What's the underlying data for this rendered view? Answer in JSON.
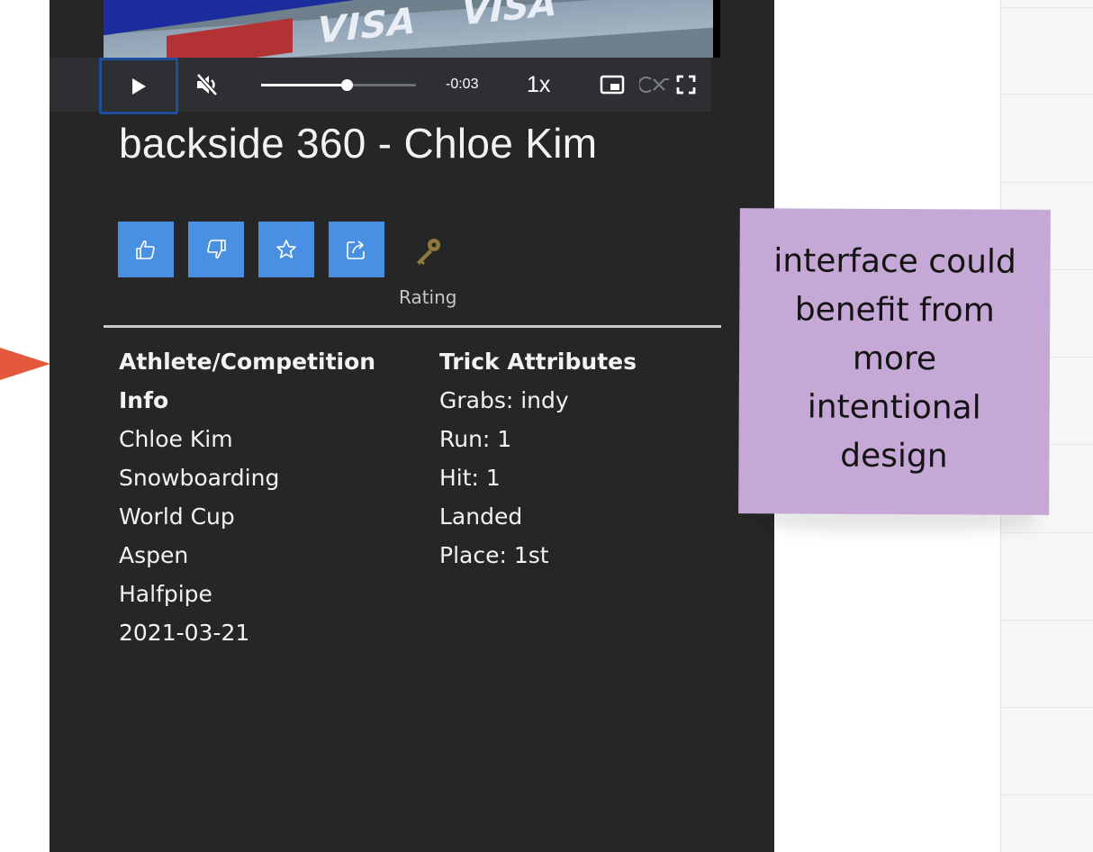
{
  "video": {
    "banner_text_1": "VISA",
    "banner_text_2": "VISA",
    "time_remaining": "-0:03",
    "playback_speed": "1x",
    "progress_fraction": 0.55
  },
  "title": "backside 360 - Chloe Kim",
  "actions": {
    "rating_label": "Rating",
    "accent_color": "#4a90e2",
    "buttons": [
      {
        "name": "like",
        "icon": "thumbs-up-icon"
      },
      {
        "name": "dislike",
        "icon": "thumbs-down-icon"
      },
      {
        "name": "favorite",
        "icon": "star-icon"
      },
      {
        "name": "share",
        "icon": "share-icon"
      }
    ]
  },
  "athlete_info": {
    "heading_line1": "Athlete/Competition",
    "heading_line2": "Info",
    "lines": [
      "Chloe Kim",
      "Snowboarding",
      "World Cup",
      "Aspen",
      "Halfpipe",
      "2021-03-21"
    ]
  },
  "trick_attributes": {
    "heading": "Trick Attributes",
    "lines": [
      "Grabs: indy",
      "Run: 1",
      "Hit: 1",
      "Landed",
      "Place: 1st"
    ]
  },
  "sticky_note": {
    "color": "#c6a8d6",
    "lines": [
      "interface could",
      "benefit from",
      "more",
      "intentional",
      "design"
    ]
  },
  "arrow_color": "#e4573b"
}
